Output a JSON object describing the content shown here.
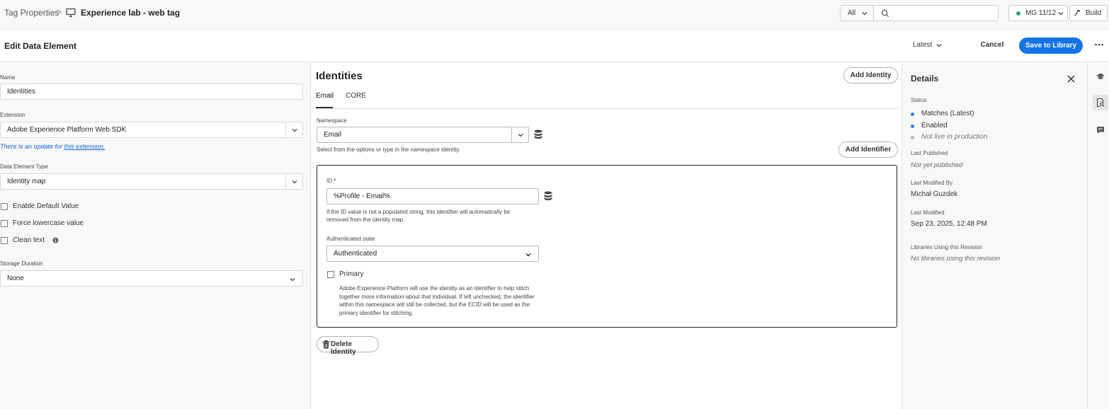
{
  "breadcrumb": {
    "root": "Tag Properties",
    "separator": ">",
    "current": "Experience lab - web tag"
  },
  "search": {
    "scope": "All",
    "placeholder": ""
  },
  "library": {
    "label": "MG 11/12",
    "status_color": "#2d9d78"
  },
  "build_label": "Build",
  "header": {
    "title": "Edit Data Element",
    "revision": "Latest",
    "cancel_label": "Cancel",
    "save_label": "Save to Library"
  },
  "form": {
    "name_label": "Name",
    "name_value": "Identities",
    "extension_label": "Extension",
    "extension_value": "Adobe Experience Platform Web SDK",
    "update_note_prefix": "There is an update for",
    "update_note_link": "this extension.",
    "type_label": "Data Element Type",
    "type_value": "Identity map",
    "enable_default": "Enable Default Value",
    "force_lowercase": "Force lowercase value",
    "clean_text": "Clean text",
    "storage_label": "Storage Duration",
    "storage_value": "None"
  },
  "identities": {
    "title": "Identities",
    "add_identity_label": "Add Identity",
    "tabs": [
      {
        "label": "Email",
        "active": true
      },
      {
        "label": "CORE",
        "active": false
      }
    ],
    "namespace_label": "Namespace",
    "namespace_value": "Email",
    "namespace_help": "Select from the options or type in the namespace identity.",
    "add_identifier_label": "Add Identifier",
    "id_label": "ID *",
    "id_value": "%Profile - Email%",
    "id_help": "If the ID value is not a populated string, this identifier will automatically be removed from the identity map.",
    "auth_label": "Authenticated state",
    "auth_value": "Authenticated",
    "primary_label": "Primary",
    "primary_help": "Adobe Experience Platform will use the identity as an identifier to help stitch together more information about that individual. If left unchecked, the identifier within this namespace will still be collected, but the ECID will be used as the primary identifier for stitching.",
    "delete_label": "Delete Identity"
  },
  "details": {
    "title": "Details",
    "status_label": "Status",
    "statuses": [
      {
        "text": "Matches (Latest)",
        "color": "#2680eb",
        "italic": false
      },
      {
        "text": "Enabled",
        "color": "#2680eb",
        "italic": false
      },
      {
        "text": "Not live in production",
        "color": "#b3b3b3",
        "italic": true
      }
    ],
    "last_published_label": "Last Published",
    "last_published_value": "Not yet published",
    "modified_by_label": "Last Modified By",
    "modified_by_value": "Michał Guzdek",
    "last_modified_label": "Last Modified",
    "last_modified_value": "Sep 23, 2025, 12:48 PM",
    "libraries_label": "Libraries Using this Revision",
    "libraries_value": "No libraries using this revision"
  },
  "colors": {
    "accent": "#1473e6",
    "status_blue": "#2680eb",
    "status_green": "#2d9d78"
  }
}
